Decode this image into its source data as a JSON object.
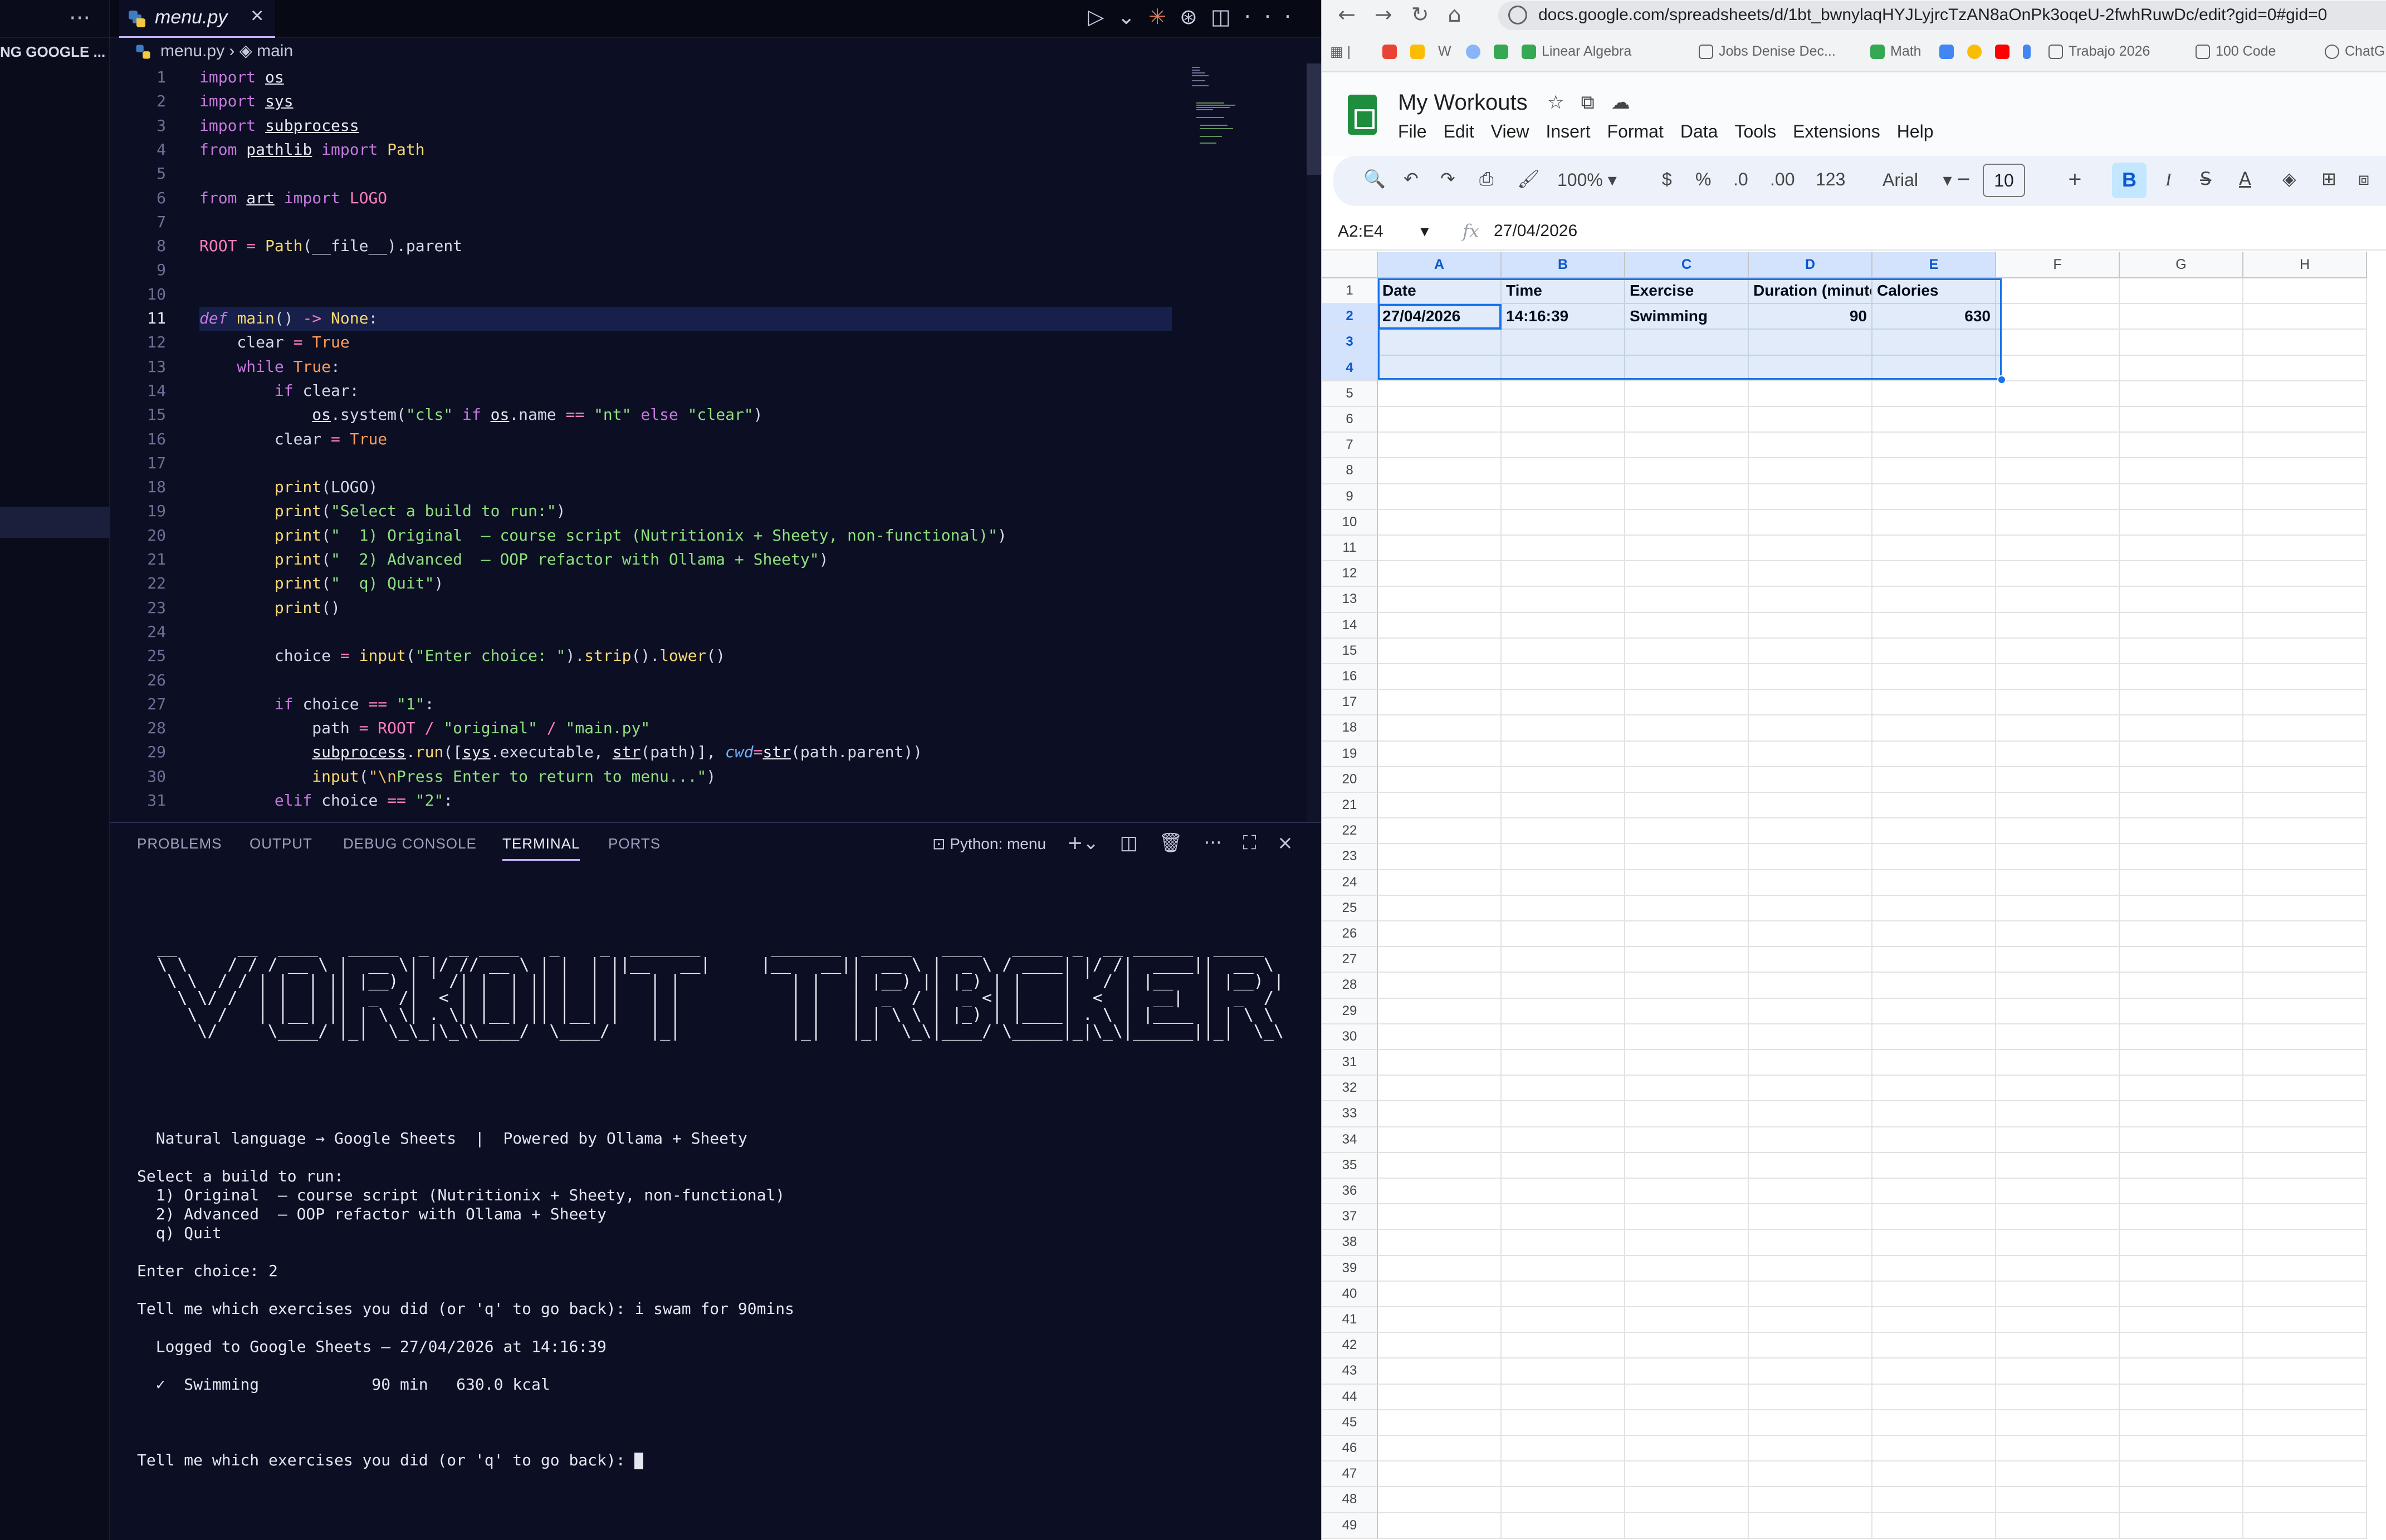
{
  "vscode": {
    "explorer_section": "NG GOOGLE ...",
    "tab_name": "menu.py",
    "breadcrumb": "menu.py  ›  ◈ main",
    "code_lines": [
      [
        [
          "import ",
          "kw"
        ],
        [
          "os",
          "mod"
        ]
      ],
      [
        [
          "import ",
          "kw"
        ],
        [
          "sys",
          "mod"
        ]
      ],
      [
        [
          "import ",
          "kw"
        ],
        [
          "subprocess",
          "mod"
        ]
      ],
      [
        [
          "from ",
          "kw"
        ],
        [
          "pathlib",
          "mod"
        ],
        [
          " import ",
          "kw"
        ],
        [
          "Path",
          "cls"
        ]
      ],
      [],
      [
        [
          "from ",
          "kw"
        ],
        [
          "art",
          "mod"
        ],
        [
          " import ",
          "kw"
        ],
        [
          "LOGO",
          "const"
        ]
      ],
      [],
      [
        [
          "ROOT",
          "const"
        ],
        [
          " = ",
          "op"
        ],
        [
          "Path",
          "cls"
        ],
        [
          "(",
          "p"
        ],
        [
          "__file__",
          "var"
        ],
        [
          ").parent",
          "p"
        ]
      ],
      [],
      [],
      [
        [
          "def ",
          "kwi"
        ],
        [
          "main",
          "fn"
        ],
        [
          "() ",
          "p"
        ],
        [
          "-> ",
          "op"
        ],
        [
          "None",
          "cls"
        ],
        [
          ":",
          "p"
        ]
      ],
      [
        [
          "    clear ",
          "var"
        ],
        [
          "= ",
          "op"
        ],
        [
          "True",
          "kwc"
        ]
      ],
      [
        [
          "    while ",
          "kw"
        ],
        [
          "True",
          "kwc"
        ],
        [
          ":",
          "p"
        ]
      ],
      [
        [
          "        if ",
          "kw"
        ],
        [
          "clear:",
          "var"
        ]
      ],
      [
        [
          "            ",
          "p"
        ],
        [
          "os",
          "mod"
        ],
        [
          ".system(",
          "p"
        ],
        [
          "\"cls\"",
          "str"
        ],
        [
          " if ",
          "kw"
        ],
        [
          "os",
          "mod"
        ],
        [
          ".name ",
          "p"
        ],
        [
          "== ",
          "op"
        ],
        [
          "\"nt\"",
          "str"
        ],
        [
          " else ",
          "kw"
        ],
        [
          "\"clear\"",
          "str"
        ],
        [
          ")",
          "p"
        ]
      ],
      [
        [
          "        clear ",
          "var"
        ],
        [
          "= ",
          "op"
        ],
        [
          "True",
          "kwc"
        ]
      ],
      [],
      [
        [
          "        ",
          "p"
        ],
        [
          "print",
          "fn"
        ],
        [
          "(LOGO)",
          "p"
        ]
      ],
      [
        [
          "        ",
          "p"
        ],
        [
          "print",
          "fn"
        ],
        [
          "(",
          "p"
        ],
        [
          "\"Select a build to run:\"",
          "str"
        ],
        [
          ")",
          "p"
        ]
      ],
      [
        [
          "        ",
          "p"
        ],
        [
          "print",
          "fn"
        ],
        [
          "(",
          "p"
        ],
        [
          "\"  1) Original  — course script (Nutritionix + Sheety, non-functional)\"",
          "str"
        ],
        [
          ")",
          "p"
        ]
      ],
      [
        [
          "        ",
          "p"
        ],
        [
          "print",
          "fn"
        ],
        [
          "(",
          "p"
        ],
        [
          "\"  2) Advanced  — OOP refactor with Ollama + Sheety\"",
          "str"
        ],
        [
          ")",
          "p"
        ]
      ],
      [
        [
          "        ",
          "p"
        ],
        [
          "print",
          "fn"
        ],
        [
          "(",
          "p"
        ],
        [
          "\"  q) Quit\"",
          "str"
        ],
        [
          ")",
          "p"
        ]
      ],
      [
        [
          "        ",
          "p"
        ],
        [
          "print",
          "fn"
        ],
        [
          "()",
          "p"
        ]
      ],
      [],
      [
        [
          "        choice ",
          "var"
        ],
        [
          "= ",
          "op"
        ],
        [
          "input",
          "fn"
        ],
        [
          "(",
          "p"
        ],
        [
          "\"Enter choice: \"",
          "str"
        ],
        [
          ").",
          "p"
        ],
        [
          "strip",
          "fn"
        ],
        [
          "().",
          "p"
        ],
        [
          "lower",
          "fn"
        ],
        [
          "()",
          "p"
        ]
      ],
      [],
      [
        [
          "        if ",
          "kw"
        ],
        [
          "choice ",
          "var"
        ],
        [
          "== ",
          "op"
        ],
        [
          "\"1\"",
          "str"
        ],
        [
          ":",
          "p"
        ]
      ],
      [
        [
          "            path ",
          "var"
        ],
        [
          "= ",
          "op"
        ],
        [
          "ROOT",
          "const"
        ],
        [
          " / ",
          "op"
        ],
        [
          "\"original\"",
          "str"
        ],
        [
          " / ",
          "op"
        ],
        [
          "\"main.py\"",
          "str"
        ]
      ],
      [
        [
          "            ",
          "p"
        ],
        [
          "subprocess",
          "mod"
        ],
        [
          ".",
          "p"
        ],
        [
          "run",
          "fn"
        ],
        [
          "([",
          "p"
        ],
        [
          "sys",
          "mod"
        ],
        [
          ".executable, ",
          "p"
        ],
        [
          "str",
          "mod"
        ],
        [
          "(path)], ",
          "p"
        ],
        [
          "cwd",
          "param"
        ],
        [
          "=",
          "op"
        ],
        [
          "str",
          "mod"
        ],
        [
          "(path.parent))",
          "p"
        ]
      ],
      [
        [
          "            ",
          "p"
        ],
        [
          "input",
          "fn"
        ],
        [
          "(",
          "p"
        ],
        [
          "\"\\n",
          "esc"
        ],
        [
          "Press Enter to return to menu...\"",
          "str"
        ],
        [
          ")",
          "p"
        ]
      ],
      [
        [
          "        elif ",
          "kw"
        ],
        [
          "choice ",
          "var"
        ],
        [
          "== ",
          "op"
        ],
        [
          "\"2\"",
          "str"
        ],
        [
          ":",
          "p"
        ]
      ]
    ],
    "panel_tabs": [
      "PROBLEMS",
      "OUTPUT",
      "DEBUG CONSOLE",
      "TERMINAL",
      "PORTS"
    ],
    "active_panel_tab": "TERMINAL",
    "terminal_name": "Python: menu",
    "terminal_art": [
      "  __      __  ____   _____  _  __ ____   _    _  _______       _______  _____   ____   _____ _  __ ______  _____  ",
      "  \\ \\    / / / __ \\ |  __ \\| |/ // __ \\ | |  | ||__   __|     |__   __||  __ \\ |  _ \\ / ____| |/ /|  ____||  __ \\ ",
      "   \\ \\  / / | |  | || |__) | ' /| |  | || |  | |   | |           | |   | |__) || |_) | |    | ' / | |__   | |__) |",
      "    \\ \\/ /  | |  | ||  _  /|  < | |  | || |  | |   | |           | |   |  _  / |  _ <| |    |  <  |  __|  |  _  / ",
      "     \\  /   | |__| || | \\ \\| . \\| |__| || |__| |   | |           | |   | | \\ \\ | |_) | |____| . \\ | |____ | | \\ \\ ",
      "      \\/     \\____/ |_|  \\_\\_|\\_\\\\____/  \\____/    |_|           |_|   |_|  \\_\\|____/ \\_____|_|\\_\\|______||_|  \\_\\"
    ],
    "terminal_lines": [
      "  Natural language → Google Sheets  |  Powered by Ollama + Sheety",
      "",
      "Select a build to run:",
      "  1) Original  — course script (Nutritionix + Sheety, non-functional)",
      "  2) Advanced  — OOP refactor with Ollama + Sheety",
      "  q) Quit",
      "",
      "Enter choice: 2",
      "",
      "Tell me which exercises you did (or 'q' to go back): i swam for 90mins",
      "",
      "  Logged to Google Sheets — 27/04/2026 at 14:16:39",
      "",
      "  ✓  Swimming            90 min   630.0 kcal",
      ""
    ],
    "terminal_prompt": "Tell me which exercises you did (or 'q' to go back): "
  },
  "browser": {
    "url": "docs.google.com/spreadsheets/d/1bt_bwnylaqHYJLyjrcTzAN8aOnPk3oqeU-2fwhRuwDc/edit?gid=0#gid=0",
    "bookmarks": [
      "Linear Algebra",
      "Jobs Denise Dec...",
      "Math",
      "Trabajo 2026",
      "100 Code",
      "ChatG"
    ],
    "doc_title": "My Workouts",
    "menus": [
      "File",
      "Edit",
      "View",
      "Insert",
      "Format",
      "Data",
      "Tools",
      "Extensions",
      "Help"
    ],
    "toolbar": {
      "zoom": "100%",
      "currency": "$",
      "percent": "%",
      "dec_decrease": ".0",
      "dec_increase": ".00",
      "number_format": "123",
      "font": "Arial",
      "font_size": "10",
      "bold": "B",
      "italic": "I"
    },
    "name_box": "A2:E4",
    "formula_value": "27/04/2026",
    "columns": [
      "A",
      "B",
      "C",
      "D",
      "E",
      "F",
      "G",
      "H"
    ],
    "rows_count": 49,
    "header_row": [
      "Date",
      "Time",
      "Exercise",
      "Duration (minutes)",
      "Calories"
    ],
    "data_rows": [
      [
        "27/04/2026",
        "14:16:39",
        "Swimming",
        "90",
        "630"
      ]
    ]
  },
  "colors": {
    "kw": "#c678dd",
    "kwi": "#c678dd",
    "kwc": "#ff9d5c",
    "mod": "#e8e9f3",
    "fn": "#f7d774",
    "cls": "#f7d774",
    "const": "#ff7cc1",
    "str": "#8ee07d",
    "op": "#ff7cc1",
    "p": "#d4d7e6",
    "var": "#d4d7e6",
    "param": "#6fb3ff",
    "esc": "#f2b86b"
  }
}
